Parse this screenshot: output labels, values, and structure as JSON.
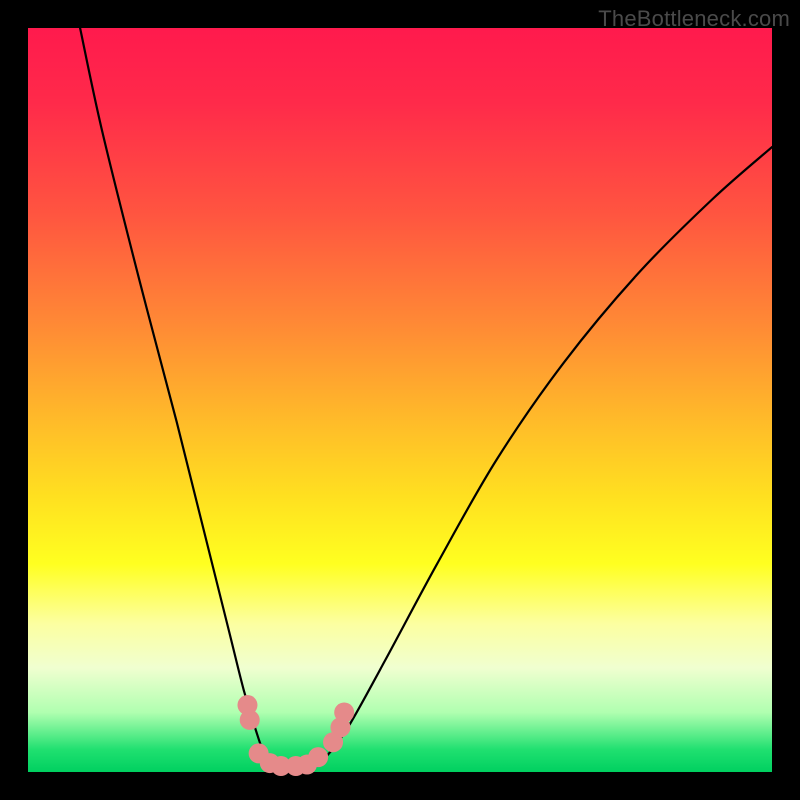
{
  "watermark": "TheBottleneck.com",
  "chart_data": {
    "type": "line",
    "title": "",
    "xlabel": "",
    "ylabel": "",
    "xlim": [
      0,
      100
    ],
    "ylim": [
      0,
      100
    ],
    "series": [
      {
        "name": "curve",
        "x": [
          7,
          10,
          15,
          20,
          24,
          27,
          29,
          30.5,
          32,
          34,
          36,
          38,
          40,
          43,
          48,
          55,
          63,
          72,
          82,
          92,
          100
        ],
        "y": [
          100,
          86,
          66,
          47,
          31,
          19,
          11,
          6,
          2,
          0.5,
          0.4,
          0.6,
          2,
          6,
          15,
          28,
          42,
          55,
          67,
          77,
          84
        ]
      }
    ],
    "markers": {
      "name": "highlight-dots",
      "color": "#e58a8a",
      "points": [
        {
          "x": 29.5,
          "y": 9
        },
        {
          "x": 29.8,
          "y": 7
        },
        {
          "x": 31,
          "y": 2.5
        },
        {
          "x": 32.5,
          "y": 1.2
        },
        {
          "x": 34,
          "y": 0.8
        },
        {
          "x": 36,
          "y": 0.8
        },
        {
          "x": 37.5,
          "y": 1
        },
        {
          "x": 39,
          "y": 2
        },
        {
          "x": 41,
          "y": 4
        },
        {
          "x": 42,
          "y": 6
        },
        {
          "x": 42.5,
          "y": 8
        }
      ]
    },
    "gradient_stops": [
      {
        "pos": 0,
        "color": "#ff1a4d"
      },
      {
        "pos": 50,
        "color": "#ffc030"
      },
      {
        "pos": 75,
        "color": "#ffff30"
      },
      {
        "pos": 100,
        "color": "#00d060"
      }
    ]
  }
}
